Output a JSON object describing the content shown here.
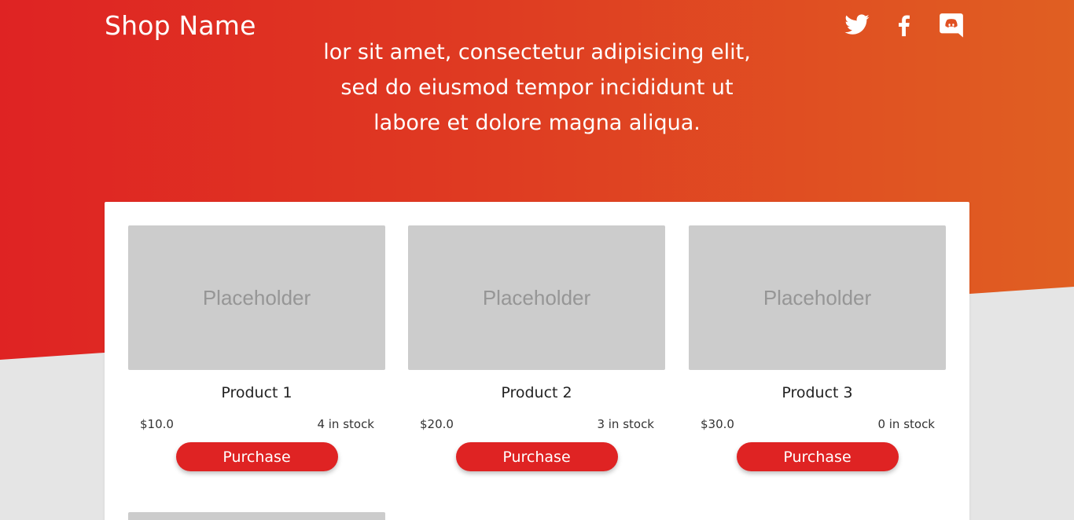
{
  "header": {
    "shop_name": "Shop Name",
    "social": [
      {
        "name": "twitter-icon"
      },
      {
        "name": "facebook-icon"
      },
      {
        "name": "discord-icon"
      }
    ]
  },
  "hero": {
    "lines": [
      "lor sit amet, consectetur adipisicing elit,",
      "sed do eiusmod tempor incididunt ut",
      "labore et dolore magna aliqua."
    ]
  },
  "products": [
    {
      "image_text": "Placeholder",
      "name": "Product 1",
      "price": "$10.0",
      "stock": "4 in stock",
      "button": "Purchase"
    },
    {
      "image_text": "Placeholder",
      "name": "Product 2",
      "price": "$20.0",
      "stock": "3 in stock",
      "button": "Purchase"
    },
    {
      "image_text": "Placeholder",
      "name": "Product 3",
      "price": "$30.0",
      "stock": "0 in stock",
      "button": "Purchase"
    }
  ],
  "colors": {
    "accent": "#df2323",
    "gradient_end": "#e05f22",
    "placeholder": "#cccccc",
    "page_bg": "#e5e5e5"
  }
}
